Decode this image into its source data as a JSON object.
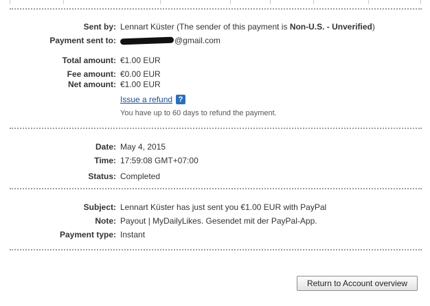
{
  "sender": {
    "label": "Sent by:",
    "name": "Lennart Küster",
    "note_prefix": "(The sender of this payment is ",
    "status": "Non-U.S. - Unverified",
    "note_suffix": ")"
  },
  "recipient": {
    "label": "Payment sent to:",
    "email_domain": "@gmail.com"
  },
  "amounts": {
    "total_label": "Total amount:",
    "total_value": "€1.00 EUR",
    "fee_label": "Fee amount:",
    "fee_value": "€0.00 EUR",
    "net_label": "Net amount:",
    "net_value": "€1.00 EUR"
  },
  "refund": {
    "link": "Issue a refund",
    "help_icon": "question-mark-icon",
    "help_glyph": "?",
    "note": "You have up to 60 days to refund the payment."
  },
  "timing": {
    "date_label": "Date:",
    "date_value": "May 4, 2015",
    "time_label": "Time:",
    "time_value": "17:59:08 GMT+07:00",
    "status_label": "Status:",
    "status_value": "Completed"
  },
  "details": {
    "subject_label": "Subject:",
    "subject_value": "Lennart Küster has just sent you €1.00 EUR with PayPal",
    "note_label": "Note:",
    "note_value": "Payout | MyDailyLikes. Gesendet mit der PayPal-App.",
    "type_label": "Payment type:",
    "type_value": "Instant"
  },
  "actions": {
    "return_label": "Return to Account overview"
  }
}
